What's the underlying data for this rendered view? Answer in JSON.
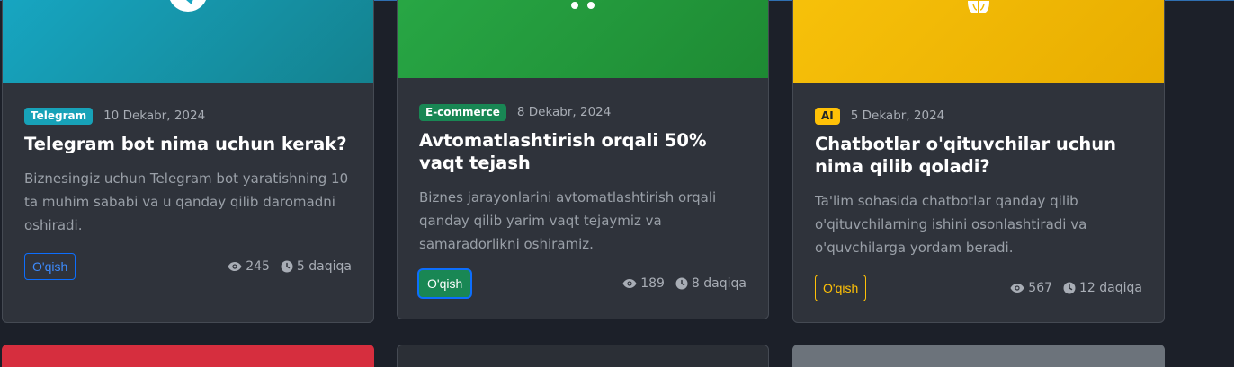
{
  "cards": [
    {
      "category": "Telegram",
      "date": "10 Dekabr, 2024",
      "title": "Telegram bot nima uchun kerak?",
      "excerpt": "Biznesingiz uchun Telegram bot yaratishning 10 ta muhim sababi va u qanday qilib daromadni oshiradi.",
      "button": "O'qish",
      "views": "245",
      "read_time": "5 daqiqa",
      "icon": "telegram-icon",
      "colors": {
        "image_from": "#17a6c2",
        "image_to": "#14828f",
        "badge": "#17a2b8",
        "badge_text": "#ffffff",
        "button": "#0d6efd"
      }
    },
    {
      "category": "E-commerce",
      "date": "8 Dekabr, 2024",
      "title": "Avtomatlashtirish orqali 50% vaqt tejash",
      "excerpt": "Biznes jarayonlarini avtomatlashtirish orqali qanday qilib yarim vaqt tejaymiz va samaradorlikni oshiramiz.",
      "button": "O'qish",
      "views": "189",
      "read_time": "8 daqiqa",
      "icon": "gears-icon",
      "colors": {
        "image_from": "#28a745",
        "image_to": "#1e8a33",
        "badge": "#198754",
        "badge_text": "#ffffff",
        "button": "#198754",
        "focus_ring": "#0d6efd"
      }
    },
    {
      "category": "AI",
      "date": "5 Dekabr, 2024",
      "title": "Chatbotlar o'qituvchilar uchun nima qilib qoladi?",
      "excerpt": "Ta'lim sohasida chatbotlar qanday qilib o'qituvchilarning ishini osonlashtiradi va o'quvchilarga yordam beradi.",
      "button": "O'qish",
      "views": "567",
      "read_time": "12 daqiqa",
      "icon": "brain-icon",
      "colors": {
        "image_from": "#f7c10a",
        "image_to": "#e8ad00",
        "badge": "#ffc107",
        "badge_text": "#212529",
        "button": "#ffc107"
      }
    }
  ],
  "next_row_colors": [
    "#d62e3e",
    "#2b2f36",
    "#6c737b"
  ]
}
